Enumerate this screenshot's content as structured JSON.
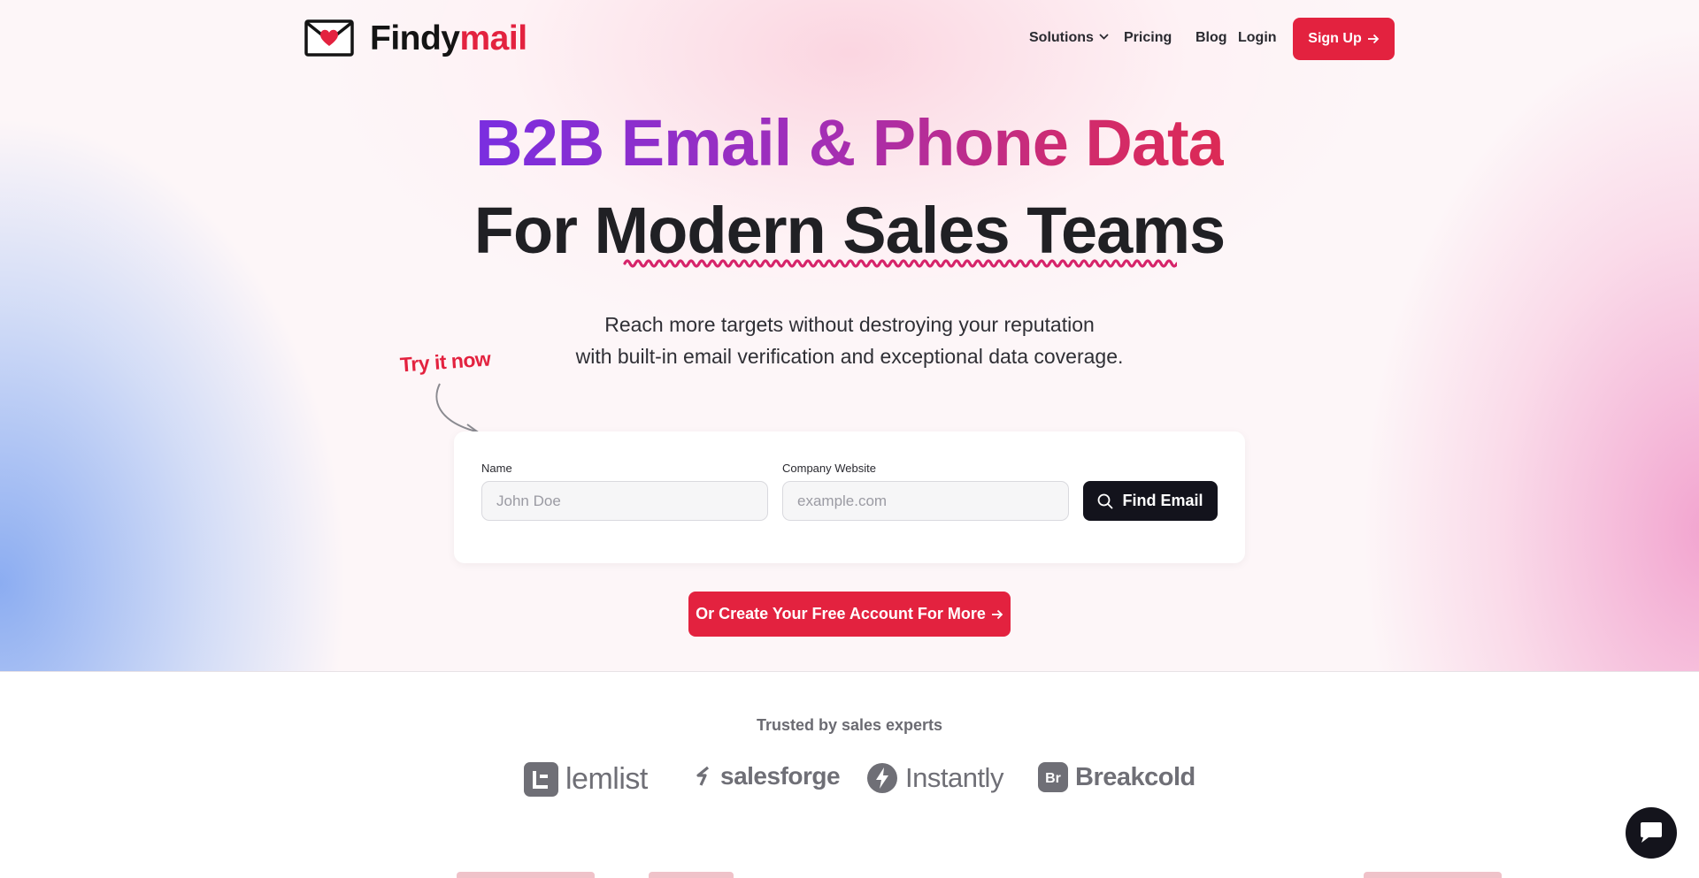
{
  "brand": {
    "name_part1": "Findy",
    "name_part2": "mail"
  },
  "nav": {
    "solutions": "Solutions",
    "pricing": "Pricing",
    "blog": "Blog",
    "login": "Login",
    "signup": "Sign Up"
  },
  "hero": {
    "headline_line1": "B2B Email & Phone Data",
    "headline_line2": "For Modern Sales Teams",
    "subtitle_line1": "Reach more targets without destroying your reputation",
    "subtitle_line2": "with built-in email verification and exceptional data coverage.",
    "try_label": "Try it now"
  },
  "form": {
    "name_label": "Name",
    "name_placeholder": "John Doe",
    "website_label": "Company Website",
    "website_placeholder": "example.com",
    "submit_label": "Find Email"
  },
  "cta": {
    "create_account": "Or Create Your Free Account For More"
  },
  "trusted": {
    "heading": "Trusted by sales experts",
    "logos": [
      "lemlist",
      "salesforge",
      "Instantly",
      "Breakcold"
    ]
  },
  "colors": {
    "accent": "#e3223f",
    "dark": "#13131c",
    "gradient_start": "#7a2ee0",
    "gradient_end": "#dc2a55"
  },
  "icons": {
    "logo": "envelope-heart-icon",
    "solutions": "chevron-down-icon",
    "signup": "arrow-right-icon",
    "find": "search-icon",
    "chat": "chat-bubble-icon"
  }
}
